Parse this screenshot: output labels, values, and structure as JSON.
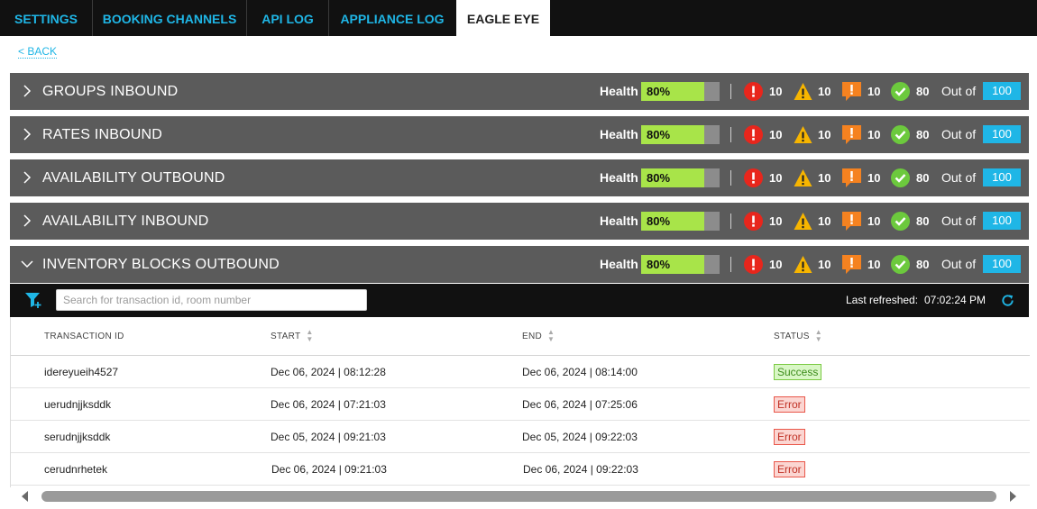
{
  "nav": {
    "tabs": [
      {
        "label": "SETTINGS"
      },
      {
        "label": "BOOKING CHANNELS"
      },
      {
        "label": "API LOG"
      },
      {
        "label": "APPLIANCE LOG"
      },
      {
        "label": "EAGLE EYE"
      }
    ],
    "active_tab": "EAGLE EYE"
  },
  "back_label": "< BACK",
  "colors": {
    "accent": "#1fb6e6",
    "panel_bg": "#5b5b5b",
    "health_fill": "#a8e449",
    "error_red": "#e8261c",
    "warning_yellow": "#f7b500",
    "alert_orange": "#f58220",
    "ok_green": "#6cc93d"
  },
  "panels": [
    {
      "title": "GROUPS INBOUND",
      "expanded": false,
      "health_label": "Health",
      "health_text": "80%",
      "health_value": 80,
      "errors": "10",
      "warnings": "10",
      "alerts": "10",
      "ok": "80",
      "out_of_label": "Out of",
      "total": "100"
    },
    {
      "title": "RATES INBOUND",
      "expanded": false,
      "health_label": "Health",
      "health_text": "80%",
      "health_value": 80,
      "errors": "10",
      "warnings": "10",
      "alerts": "10",
      "ok": "80",
      "out_of_label": "Out of",
      "total": "100"
    },
    {
      "title": "AVAILABILITY OUTBOUND",
      "expanded": false,
      "health_label": "Health",
      "health_text": "80%",
      "health_value": 80,
      "errors": "10",
      "warnings": "10",
      "alerts": "10",
      "ok": "80",
      "out_of_label": "Out of",
      "total": "100"
    },
    {
      "title": "AVAILABILITY INBOUND",
      "expanded": false,
      "health_label": "Health",
      "health_text": "80%",
      "health_value": 80,
      "errors": "10",
      "warnings": "10",
      "alerts": "10",
      "ok": "80",
      "out_of_label": "Out of",
      "total": "100"
    },
    {
      "title": "INVENTORY BLOCKS OUTBOUND",
      "expanded": true,
      "health_label": "Health",
      "health_text": "80%",
      "health_value": 80,
      "errors": "10",
      "warnings": "10",
      "alerts": "10",
      "ok": "80",
      "out_of_label": "Out of",
      "total": "100"
    }
  ],
  "icons": {
    "filter": "filter-add-icon",
    "error": "error-circle-icon",
    "warning": "warning-triangle-icon",
    "alert": "alert-square-icon",
    "ok": "check-circle-icon",
    "refresh": "refresh-icon"
  },
  "toolbar": {
    "search_placeholder": "Search for transaction id, room number",
    "search_value": "",
    "last_refreshed_label": "Last refreshed:",
    "last_refreshed_time": "07:02:24 PM"
  },
  "table": {
    "columns": [
      "TRANSACTION ID",
      "START",
      "END",
      "STATUS"
    ],
    "rows": [
      {
        "id": "idereyueih4527",
        "start": "Dec 06, 2024 | 08:12:28",
        "end": "Dec 06, 2024 | 08:14:00",
        "status": "Success"
      },
      {
        "id": "uerudnjjksddk",
        "start": "Dec 06, 2024 | 07:21:03",
        "end": "Dec 06, 2024 | 07:25:06",
        "status": "Error"
      },
      {
        "id": "serudnjjksddk",
        "start": "Dec 05, 2024 | 09:21:03",
        "end": "Dec 05, 2024 | 09:22:03",
        "status": "Error"
      },
      {
        "id": "cerudnrhetek",
        "start": "Dec 06, 2024 | 09:21:03",
        "end": "Dec 06, 2024 | 09:22:03",
        "status": "Error"
      }
    ]
  }
}
